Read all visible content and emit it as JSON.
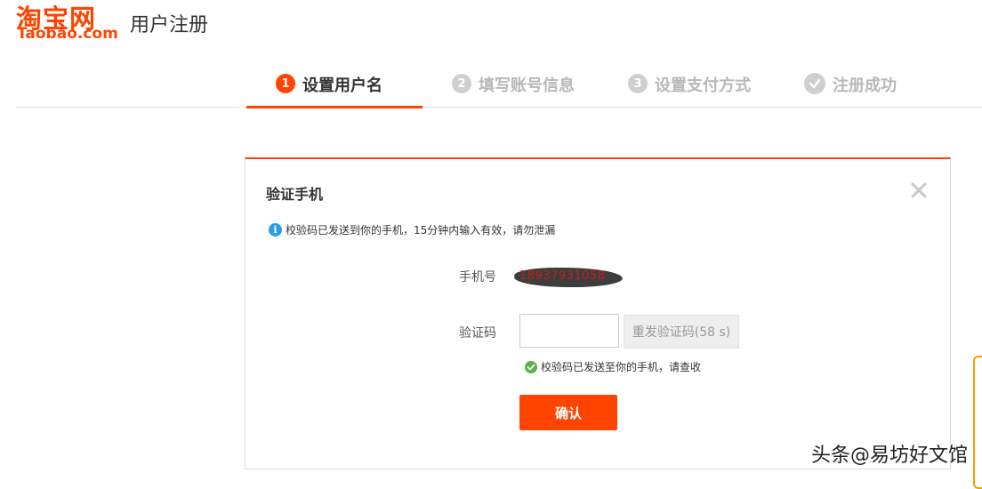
{
  "header": {
    "logo_cn": "淘宝网",
    "logo_en": "Taobao.com",
    "subtitle": "用户注册"
  },
  "steps": [
    {
      "num": "1",
      "label": "设置用户名",
      "state": "active"
    },
    {
      "num": "2",
      "label": "填写账号信息",
      "state": "inactive"
    },
    {
      "num": "3",
      "label": "设置支付方式",
      "state": "inactive"
    },
    {
      "num": "",
      "label": "注册成功",
      "state": "inactive",
      "icon": "check-icon"
    }
  ],
  "dialog": {
    "title": "验证手机",
    "close_symbol": "✕",
    "info_text": "校验码已发送到你的手机，15分钟内输入有效，请勿泄漏",
    "phone_label": "手机号",
    "phone_value": "18937931058",
    "code_label": "验证码",
    "code_value": "",
    "code_placeholder": "",
    "resend_label": "重发验证码(58 s)",
    "success_text": "校验码已发送至你的手机，请查收",
    "confirm_label": "确认"
  },
  "watermark": "头条@易坊好文馆",
  "colors": {
    "brand": "#ff4400",
    "info": "#2a9de6",
    "success": "#56b545",
    "edge_panel": "#f0a000"
  }
}
